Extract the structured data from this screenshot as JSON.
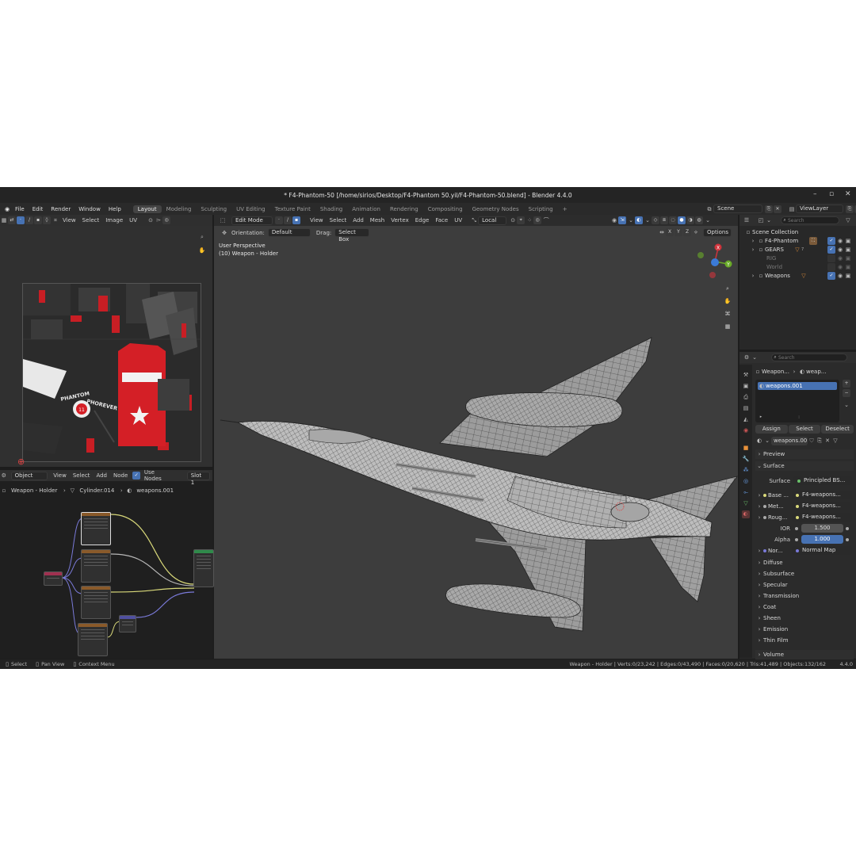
{
  "window": {
    "title": "* F4-Phantom-50 [/home/sirios/Desktop/F4-Phantom 50.yil/F4-Phantom-50.blend] - Blender 4.4.0"
  },
  "menu": [
    "File",
    "Edit",
    "Render",
    "Window",
    "Help"
  ],
  "workspaces": [
    "Layout",
    "Modeling",
    "Sculpting",
    "UV Editing",
    "Texture Paint",
    "Shading",
    "Animation",
    "Rendering",
    "Compositing",
    "Geometry Nodes",
    "Scripting"
  ],
  "workspace_add": "+",
  "scene": {
    "label": "Scene",
    "view_layer": "ViewLayer"
  },
  "uv_editor": {
    "menus": [
      "View",
      "Select",
      "Image",
      "UV"
    ],
    "decal_text_1": "PHANTOM",
    "decal_text_2": "PHOREVER",
    "decal_badge": "11"
  },
  "node_editor": {
    "mode": "Object",
    "menus": [
      "View",
      "Select",
      "Add",
      "Node"
    ],
    "use_nodes_label": "Use Nodes",
    "slot": "Slot 1",
    "breadcrumb": [
      "Weapon - Holder",
      "Cylinder.014",
      "weapons.001"
    ]
  },
  "viewport": {
    "mode": "Edit Mode",
    "menus": [
      "View",
      "Select",
      "Add",
      "Mesh",
      "Vertex",
      "Edge",
      "Face",
      "UV"
    ],
    "pivot": "Local",
    "orientation_label": "Orientation:",
    "orientation_value": "Default",
    "drag_label": "Drag:",
    "drag_value": "Select Box",
    "options": "Options",
    "axes": [
      "X",
      "Y",
      "Z"
    ],
    "overlay_line1": "User Perspective",
    "overlay_line2": "(10) Weapon - Holder"
  },
  "outliner": {
    "search_placeholder": "Search",
    "root": "Scene Collection",
    "items": [
      {
        "name": "F4-Phantom",
        "dim": false
      },
      {
        "name": "GEARS",
        "dim": false
      },
      {
        "name": "RIG",
        "dim": true
      },
      {
        "name": "World",
        "dim": true
      },
      {
        "name": "Weapons",
        "dim": false
      }
    ],
    "counts": {
      "gears": "7"
    }
  },
  "properties": {
    "search_placeholder": "Search",
    "breadcrumb": [
      "Weapon...",
      "weap..."
    ],
    "slot_name": "weapons.001",
    "buttons": [
      "Assign",
      "Select",
      "Deselect"
    ],
    "material_name": "weapons.001",
    "preview_label": "Preview",
    "surface_section": "Surface",
    "surface_label": "Surface",
    "surface_value": "Principled BS...",
    "rows": [
      {
        "label": "Base ...",
        "value": "F4-weapons..."
      },
      {
        "label": "Met...",
        "value": "F4-weapons..."
      },
      {
        "label": "Roug...",
        "value": "F4-weapons..."
      }
    ],
    "ior_label": "IOR",
    "ior_value": "1.500",
    "alpha_label": "Alpha",
    "alpha_value": "1.000",
    "normal_label": "Nor...",
    "normal_value": "Normal Map",
    "subsections": [
      "Diffuse",
      "Subsurface",
      "Specular",
      "Transmission",
      "Coat",
      "Sheen",
      "Emission",
      "Thin Film"
    ],
    "volume_label": "Volume"
  },
  "statusbar": {
    "hints": [
      "Select",
      "Pan View",
      "Context Menu"
    ],
    "stats": "Weapon - Holder | Verts:0/23,242 | Edges:0/43,490 | Faces:0/20,620 | Tris:41,489 | Objects:132/162",
    "version": "4.4.0"
  },
  "colors": {
    "accent_blue": "#4772b3",
    "axis_x": "#d0343c",
    "axis_y": "#6aab28",
    "axis_z": "#3b7bd8"
  }
}
